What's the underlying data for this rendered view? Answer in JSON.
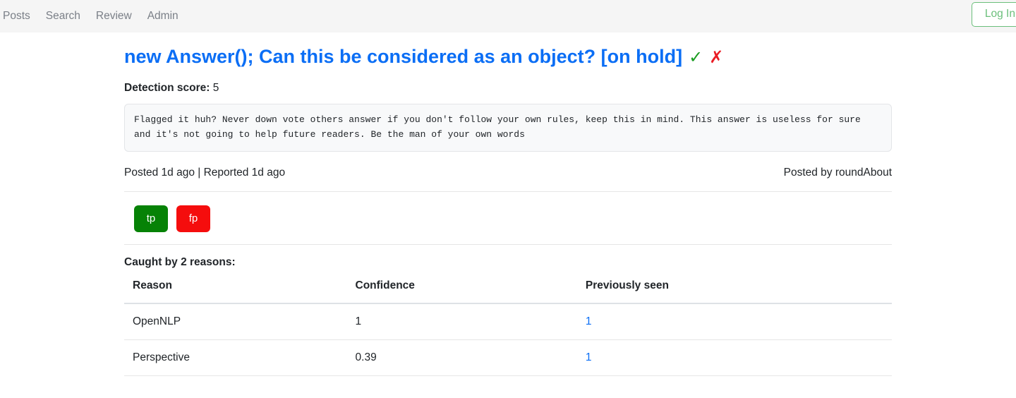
{
  "navbar": {
    "items": [
      {
        "label": "Posts"
      },
      {
        "label": "Search"
      },
      {
        "label": "Review"
      },
      {
        "label": "Admin"
      }
    ],
    "login_label": "Log In",
    "accent_green": "#6bbf7b",
    "background": "#f5f5f5"
  },
  "post": {
    "title": "new Answer(); Can this be considered as an object? [on hold]",
    "title_color": "#0b6ef5",
    "check_icon": "✓",
    "check_color": "#1a9c22",
    "x_icon": "✗",
    "x_color": "#ea1c24",
    "detection_label": "Detection score:",
    "detection_score": "5",
    "body": "Flagged it huh? Never down vote others answer if you don't follow your own rules, keep this in mind. This answer is useless for sure and it's not going to help future readers. Be the man of your own words",
    "posted_reported": "Posted 1d ago | Reported 1d ago",
    "posted_by": "Posted by roundAbout"
  },
  "feedback": {
    "tp_label": "tp",
    "tp_color": "#068206",
    "fp_label": "fp",
    "fp_color": "#f50d0d"
  },
  "reasons_section": {
    "heading": "Caught by 2 reasons:",
    "columns": {
      "reason": "Reason",
      "confidence": "Confidence",
      "previously_seen": "Previously seen"
    },
    "rows": [
      {
        "reason": "OpenNLP",
        "confidence": "1",
        "previously_seen": "1"
      },
      {
        "reason": "Perspective",
        "confidence": "0.39",
        "previously_seen": "1"
      }
    ]
  }
}
